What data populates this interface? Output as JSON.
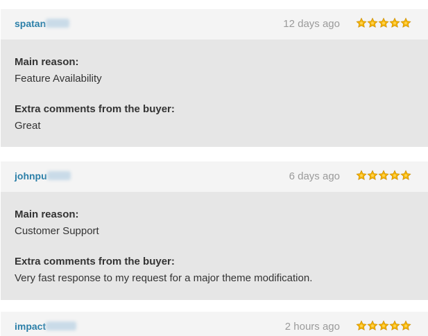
{
  "reviews": [
    {
      "username": "spatan",
      "time": "12 days ago",
      "rating": 5,
      "main_reason_label": "Main reason:",
      "main_reason": "Feature Availability",
      "comments_label": "Extra comments from the buyer:",
      "comments": "Great"
    },
    {
      "username": "johnpu",
      "time": "6 days ago",
      "rating": 5,
      "main_reason_label": "Main reason:",
      "main_reason": "Customer Support",
      "comments_label": "Extra comments from the buyer:",
      "comments": "Very fast response to my request for a major theme modification."
    },
    {
      "username": "impact",
      "time": "2 hours ago",
      "rating": 5
    }
  ],
  "colors": {
    "username": "#2b7fa8",
    "star": "#f5b400",
    "header_bg": "#f4f4f4",
    "body_bg": "#e6e6e6"
  },
  "icons": {
    "star": "star-icon"
  }
}
